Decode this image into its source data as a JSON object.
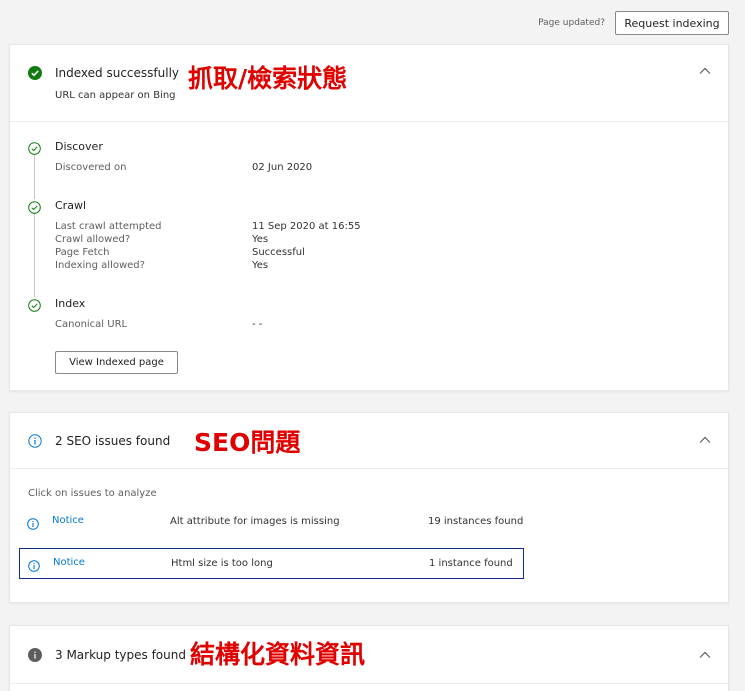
{
  "topbar": {
    "page_updated": "Page updated?",
    "request_indexing": "Request indexing"
  },
  "index_card": {
    "title": "Indexed successfully",
    "subtitle": "URL can appear on Bing",
    "annotation": "抓取/檢索狀態",
    "steps": [
      {
        "title": "Discover",
        "rows": [
          {
            "label": "Discovered on",
            "value": "02 Jun 2020"
          }
        ]
      },
      {
        "title": "Crawl",
        "rows": [
          {
            "label": "Last crawl attempted",
            "value": "11 Sep 2020 at 16:55"
          },
          {
            "label": "Crawl allowed?",
            "value": "Yes"
          },
          {
            "label": "Page Fetch",
            "value": "Successful"
          },
          {
            "label": "Indexing allowed?",
            "value": "Yes"
          }
        ]
      },
      {
        "title": "Index",
        "rows": [
          {
            "label": "Canonical URL",
            "value": "- -"
          }
        ]
      }
    ],
    "view_indexed_page": "View Indexed page"
  },
  "seo_card": {
    "title": "2 SEO issues found",
    "annotation": "SEO問題",
    "hint": "Click on issues to analyze",
    "issues": [
      {
        "severity": "Notice",
        "description": "Alt attribute for images is missing",
        "count": "19 instances found"
      },
      {
        "severity": "Notice",
        "description": "Html size is too long",
        "count": "1 instance found"
      }
    ]
  },
  "markup_card": {
    "title": "3 Markup types found",
    "annotation": "結構化資料資訊"
  },
  "colors": {
    "success": "#107c10",
    "info": "#0078d4",
    "neutral": "#605e5c",
    "annotation": "#e00000",
    "selected_border": "#0f2b8c"
  }
}
